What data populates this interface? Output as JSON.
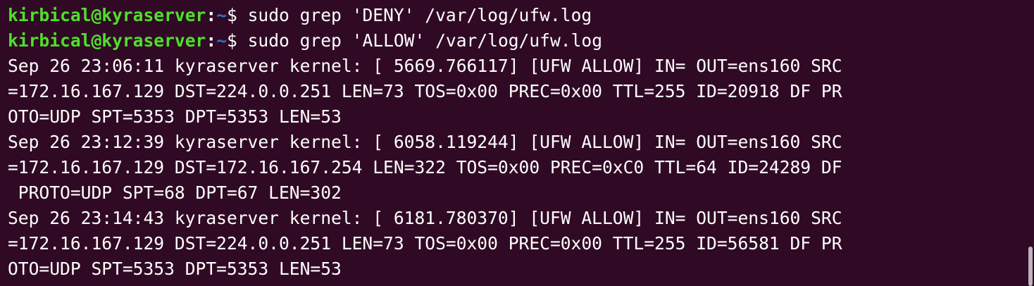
{
  "prompt": {
    "user_host": "kirbical@kyraserver",
    "colon": ":",
    "cwd": "~",
    "dollar": "$ "
  },
  "commands": [
    "sudo grep 'DENY' /var/log/ufw.log",
    "sudo grep 'ALLOW' /var/log/ufw.log"
  ],
  "output_lines": [
    "Sep 26 23:06:11 kyraserver kernel: [ 5669.766117] [UFW ALLOW] IN= OUT=ens160 SRC",
    "=172.16.167.129 DST=224.0.0.251 LEN=73 TOS=0x00 PREC=0x00 TTL=255 ID=20918 DF PR",
    "OTO=UDP SPT=5353 DPT=5353 LEN=53",
    "Sep 26 23:12:39 kyraserver kernel: [ 6058.119244] [UFW ALLOW] IN= OUT=ens160 SRC",
    "=172.16.167.129 DST=172.16.167.254 LEN=322 TOS=0x00 PREC=0xC0 TTL=64 ID=24289 DF",
    " PROTO=UDP SPT=68 DPT=67 LEN=302",
    "Sep 26 23:14:43 kyraserver kernel: [ 6181.780370] [UFW ALLOW] IN= OUT=ens160 SRC",
    "=172.16.167.129 DST=224.0.0.251 LEN=73 TOS=0x00 PREC=0x00 TTL=255 ID=56581 DF PR",
    "OTO=UDP SPT=5353 DPT=5353 LEN=53"
  ],
  "colors": {
    "background": "#300a24",
    "prompt_user_host": "#4ee02a",
    "prompt_cwd": "#2f6fd0",
    "text": "#ffffff"
  }
}
